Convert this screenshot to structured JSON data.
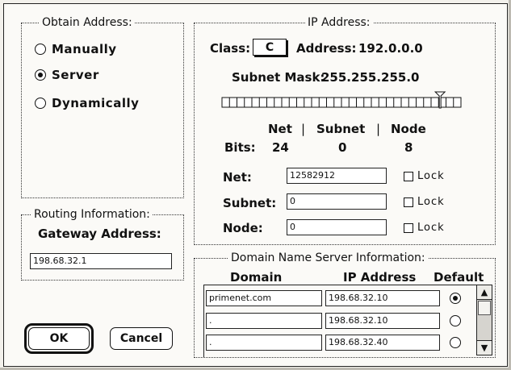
{
  "obtain_address": {
    "title": "Obtain Address:",
    "options": [
      {
        "label": "Manually",
        "selected": false
      },
      {
        "label": "Server",
        "selected": true
      },
      {
        "label": "Dynamically",
        "selected": false
      }
    ]
  },
  "routing": {
    "title": "Routing Information:",
    "gateway_label": "Gateway Address:",
    "gateway_value": "198.68.32.1"
  },
  "ip_address": {
    "title": "IP Address:",
    "class_label": "Class:",
    "class_value": "C",
    "address_label": "Address:",
    "address_value": "192.0.0.0",
    "subnet_mask_label": "Subnet Mask:",
    "subnet_mask_value": "255.255.255.0",
    "slider_value_fraction": 0.96,
    "bits_headers": {
      "net": "Net",
      "sep1": "|",
      "subnet": "Subnet",
      "sep2": "|",
      "node": "Node"
    },
    "bits_label": "Bits:",
    "bits_values": {
      "net": "24",
      "subnet": "0",
      "node": "8"
    },
    "fields": [
      {
        "label": "Net:",
        "value": "12582912",
        "lock_label": "Lock"
      },
      {
        "label": "Subnet:",
        "value": "0",
        "lock_label": "Lock"
      },
      {
        "label": "Node:",
        "value": "0",
        "lock_label": "Lock"
      }
    ]
  },
  "dns": {
    "title": "Domain Name Server Information:",
    "columns": {
      "domain": "Domain",
      "ip": "IP Address",
      "default": "Default"
    },
    "rows": [
      {
        "domain": "primenet.com",
        "ip": "198.68.32.10",
        "default": true
      },
      {
        "domain": ".",
        "ip": "198.68.32.10",
        "default": false
      },
      {
        "domain": ".",
        "ip": "198.68.32.40",
        "default": false
      }
    ]
  },
  "buttons": {
    "ok": "OK",
    "cancel": "Cancel"
  },
  "icons": {
    "scroll_up": "up-arrow-icon",
    "scroll_down": "down-arrow-icon",
    "slider_marker": "slider-pointer-icon"
  }
}
